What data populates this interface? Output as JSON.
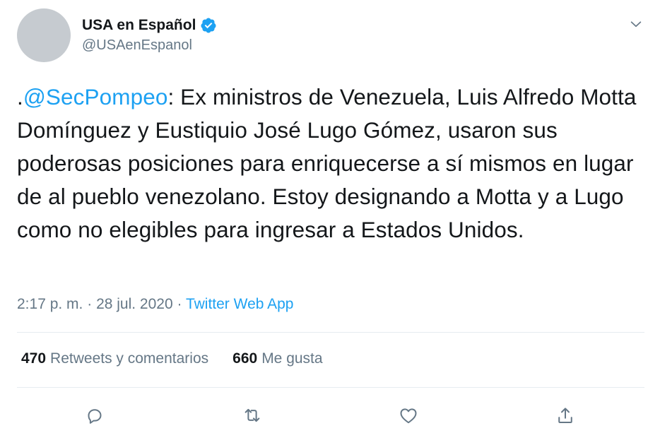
{
  "author": {
    "display_name": "USA en Español",
    "handle": "@USAenEspanol",
    "verified": true
  },
  "tweet": {
    "prefix": ".",
    "mention": "@SecPompeo",
    "body": ": Ex ministros de Venezuela, Luis Alfredo Motta Domínguez y Eustiquio José Lugo Gómez, usaron sus poderosas posiciones para enriquecerse a sí mismos en lugar de al pueblo venezolano. Estoy designando a Motta y a Lugo como no elegibles para ingresar a Estados Unidos."
  },
  "meta": {
    "time": "2:17 p. m.",
    "sep1": " · ",
    "date": "28 jul. 2020",
    "sep2": " · ",
    "source": "Twitter Web App"
  },
  "stats": {
    "retweets_count": "470",
    "retweets_label": "Retweets y comentarios",
    "likes_count": "660",
    "likes_label": "Me gusta"
  },
  "icons": {
    "verified": "verified-badge-icon",
    "menu": "chevron-down-icon",
    "reply": "reply-icon",
    "retweet": "retweet-icon",
    "like": "heart-icon",
    "share": "share-icon"
  },
  "colors": {
    "accent": "#1da1f2",
    "text": "#14171a",
    "muted": "#657786",
    "divider": "#e6ecf0",
    "avatar": "#c6cbd0"
  }
}
